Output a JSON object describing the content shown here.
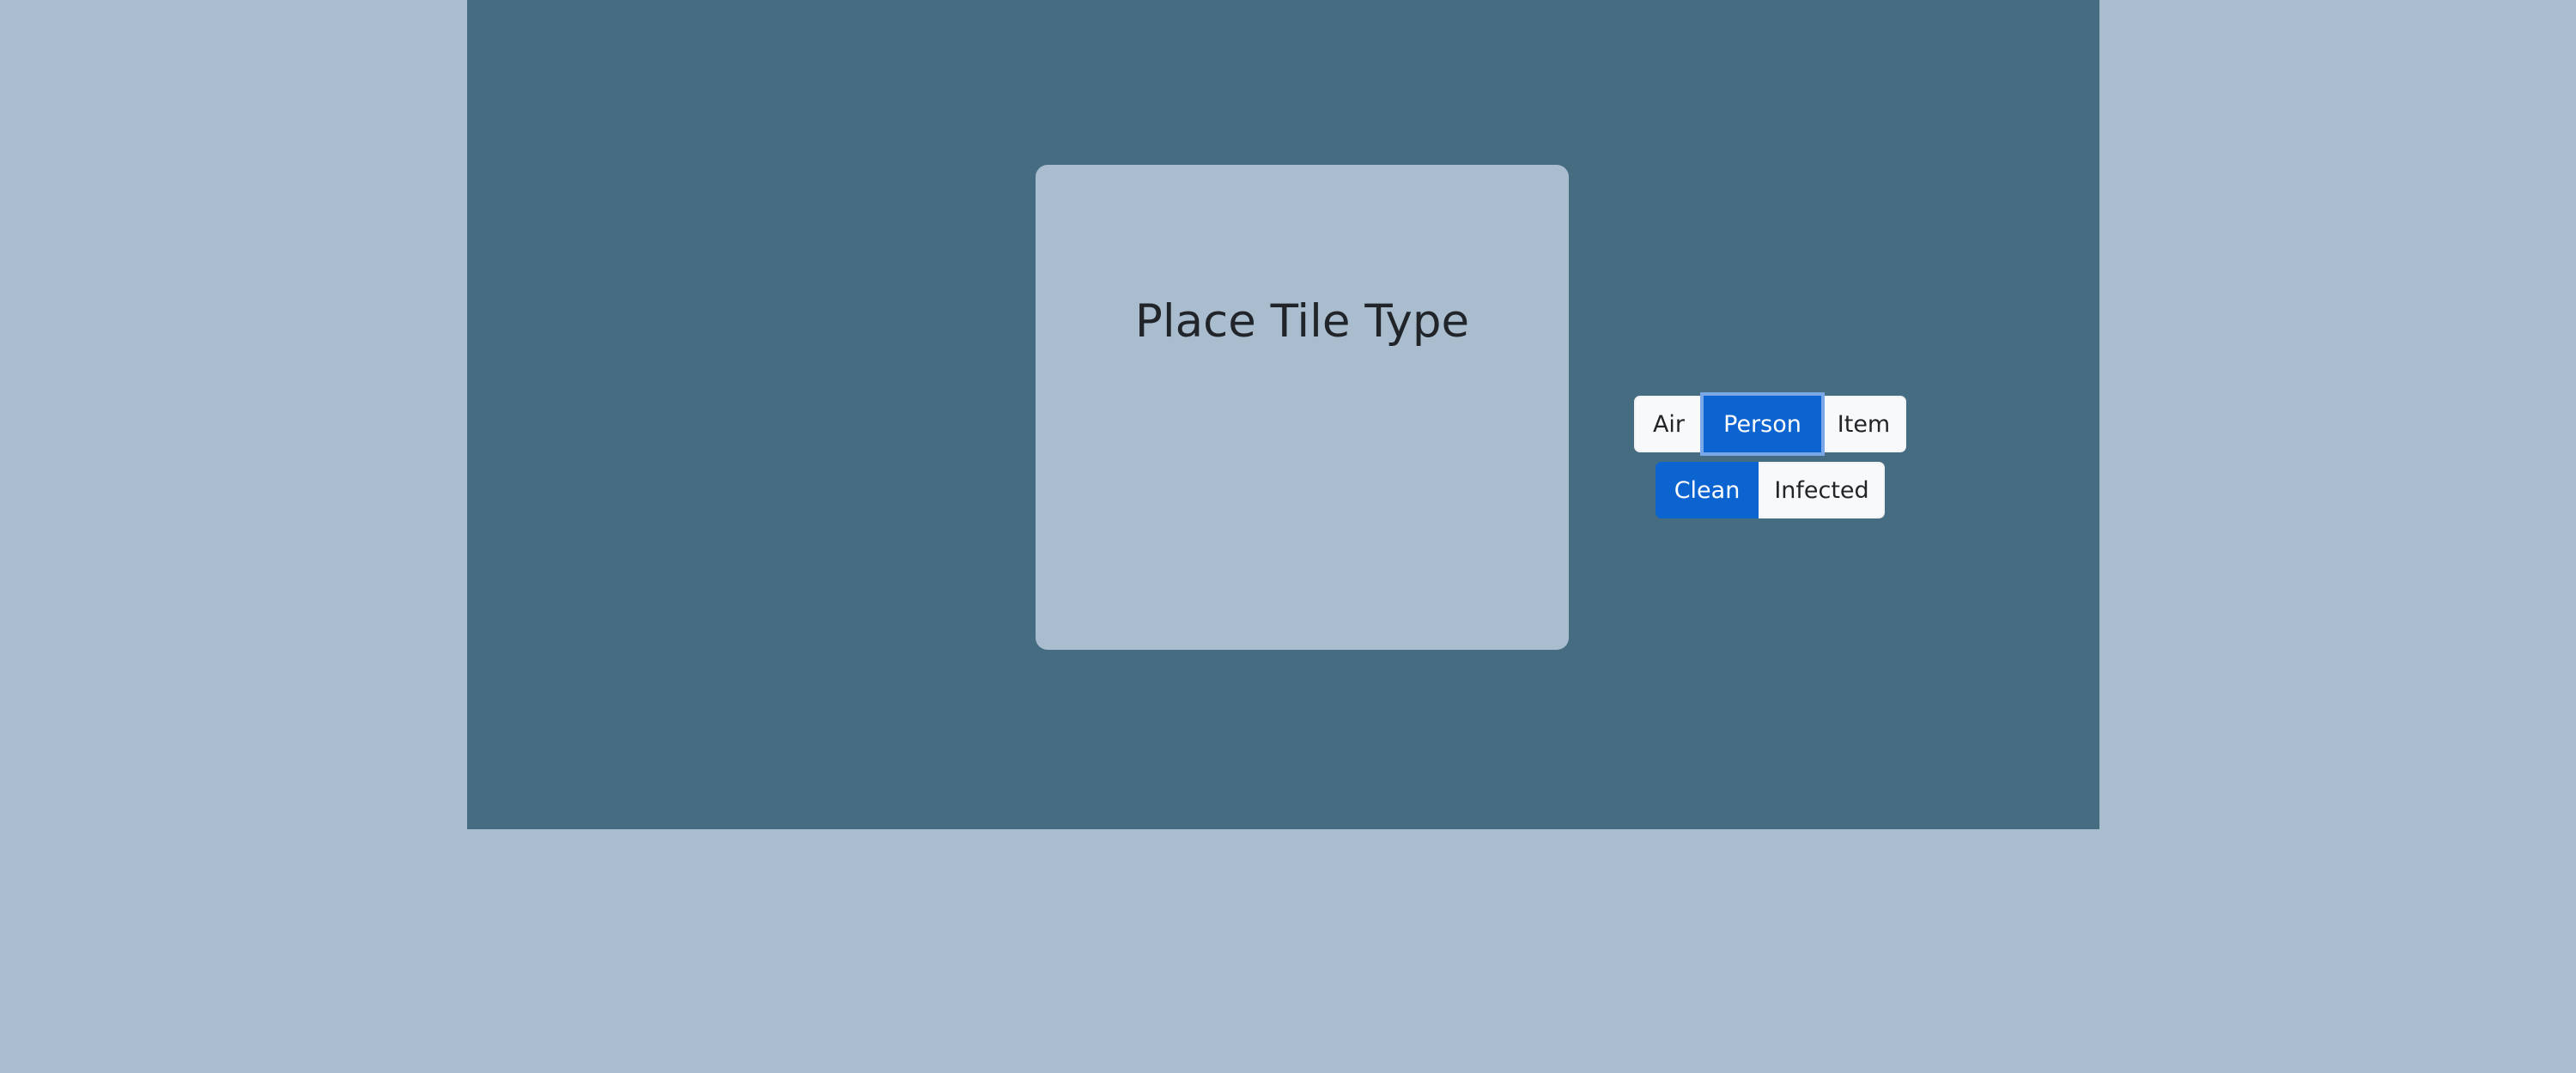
{
  "dialog": {
    "title": "Place Tile Type",
    "tile_types": [
      {
        "label": "Air",
        "selected": false
      },
      {
        "label": "Person",
        "selected": true
      },
      {
        "label": "Item",
        "selected": false
      }
    ],
    "status_options": [
      {
        "label": "Clean",
        "selected": true
      },
      {
        "label": "Infected",
        "selected": false
      }
    ]
  },
  "colors": {
    "page_background": "#a9bdcf",
    "stage_background": "#456c81",
    "dialog_background": "#a9bdcf",
    "active_button": "#0b64d0",
    "inactive_button": "#f8f9fa"
  }
}
